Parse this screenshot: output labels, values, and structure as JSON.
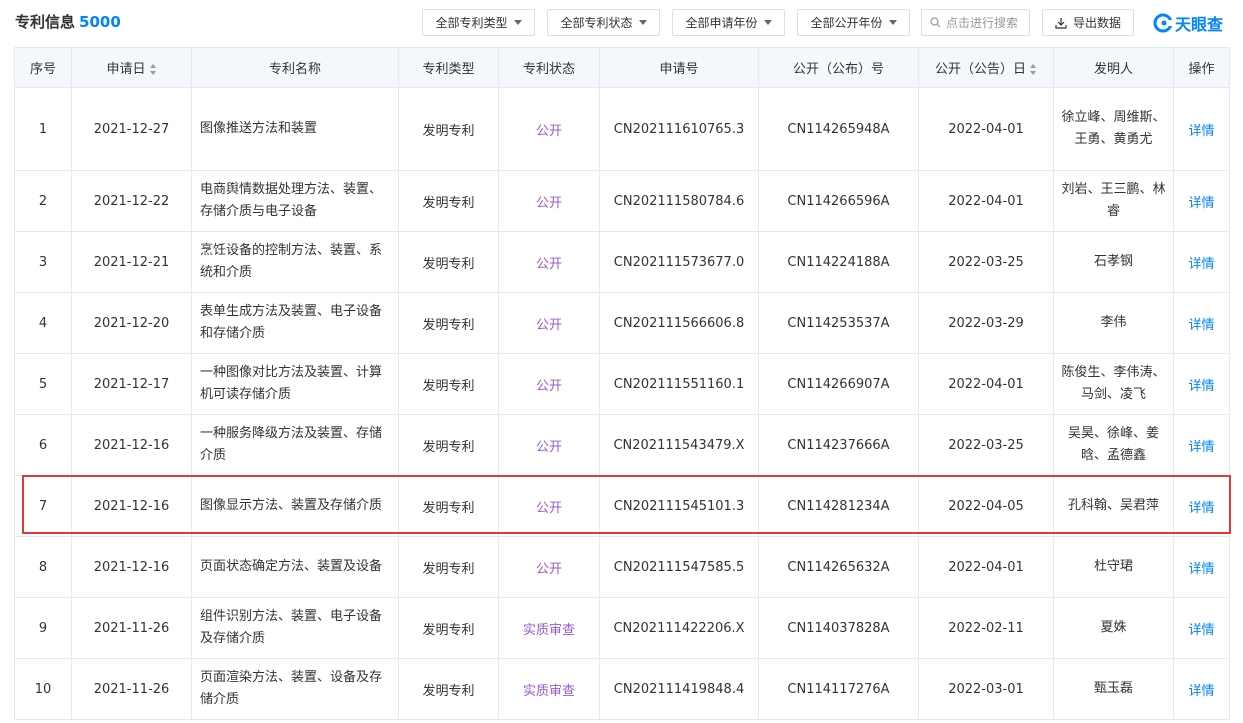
{
  "header": {
    "title": "专利信息",
    "count": "5000",
    "filters": [
      "全部专利类型",
      "全部专利状态",
      "全部申请年份",
      "全部公开年份"
    ],
    "search_placeholder": "点击进行搜索",
    "export_label": "导出数据",
    "logo_text": "天眼查"
  },
  "table": {
    "columns": [
      "序号",
      "申请日",
      "专利名称",
      "专利类型",
      "专利状态",
      "申请号",
      "公开（公布）号",
      "公开（公告）日",
      "发明人",
      "操作"
    ],
    "rows": [
      {
        "no": "1",
        "date": "2021-12-27",
        "name": "图像推送方法和装置",
        "type": "发明专利",
        "status": "公开",
        "app_no": "CN202111610765.3",
        "pub_no": "CN114265948A",
        "pub_date": "2022-04-01",
        "inventor": "徐立峰、周维斯、王勇、黄勇尤",
        "action": "详情"
      },
      {
        "no": "2",
        "date": "2021-12-22",
        "name": "电商舆情数据处理方法、装置、存储介质与电子设备",
        "type": "发明专利",
        "status": "公开",
        "app_no": "CN202111580784.6",
        "pub_no": "CN114266596A",
        "pub_date": "2022-04-01",
        "inventor": "刘岩、王三鹏、林睿",
        "action": "详情"
      },
      {
        "no": "3",
        "date": "2021-12-21",
        "name": "烹饪设备的控制方法、装置、系统和介质",
        "type": "发明专利",
        "status": "公开",
        "app_no": "CN202111573677.0",
        "pub_no": "CN114224188A",
        "pub_date": "2022-03-25",
        "inventor": "石孝钢",
        "action": "详情"
      },
      {
        "no": "4",
        "date": "2021-12-20",
        "name": "表单生成方法及装置、电子设备和存储介质",
        "type": "发明专利",
        "status": "公开",
        "app_no": "CN202111566606.8",
        "pub_no": "CN114253537A",
        "pub_date": "2022-03-29",
        "inventor": "李伟",
        "action": "详情"
      },
      {
        "no": "5",
        "date": "2021-12-17",
        "name": "一种图像对比方法及装置、计算机可读存储介质",
        "type": "发明专利",
        "status": "公开",
        "app_no": "CN202111551160.1",
        "pub_no": "CN114266907A",
        "pub_date": "2022-04-01",
        "inventor": "陈俊生、李伟涛、马剑、凌飞",
        "action": "详情"
      },
      {
        "no": "6",
        "date": "2021-12-16",
        "name": "一种服务降级方法及装置、存储介质",
        "type": "发明专利",
        "status": "公开",
        "app_no": "CN202111543479.X",
        "pub_no": "CN114237666A",
        "pub_date": "2022-03-25",
        "inventor": "吴昊、徐峰、姜晗、孟德鑫",
        "action": "详情"
      },
      {
        "no": "7",
        "date": "2021-12-16",
        "name": "图像显示方法、装置及存储介质",
        "type": "发明专利",
        "status": "公开",
        "app_no": "CN202111545101.3",
        "pub_no": "CN114281234A",
        "pub_date": "2022-04-05",
        "inventor": "孔科翰、吴君萍",
        "action": "详情"
      },
      {
        "no": "8",
        "date": "2021-12-16",
        "name": "页面状态确定方法、装置及设备",
        "type": "发明专利",
        "status": "公开",
        "app_no": "CN202111547585.5",
        "pub_no": "CN114265632A",
        "pub_date": "2022-04-01",
        "inventor": "杜守珺",
        "action": "详情"
      },
      {
        "no": "9",
        "date": "2021-11-26",
        "name": "组件识别方法、装置、电子设备及存储介质",
        "type": "发明专利",
        "status": "实质审查",
        "app_no": "CN202111422206.X",
        "pub_no": "CN114037828A",
        "pub_date": "2022-02-11",
        "inventor": "夏姝",
        "action": "详情"
      },
      {
        "no": "10",
        "date": "2021-11-26",
        "name": "页面渲染方法、装置、设备及存储介质",
        "type": "发明专利",
        "status": "实质审查",
        "app_no": "CN202111419848.4",
        "pub_no": "CN114117276A",
        "pub_date": "2022-03-01",
        "inventor": "甄玉磊",
        "action": "详情"
      }
    ]
  }
}
